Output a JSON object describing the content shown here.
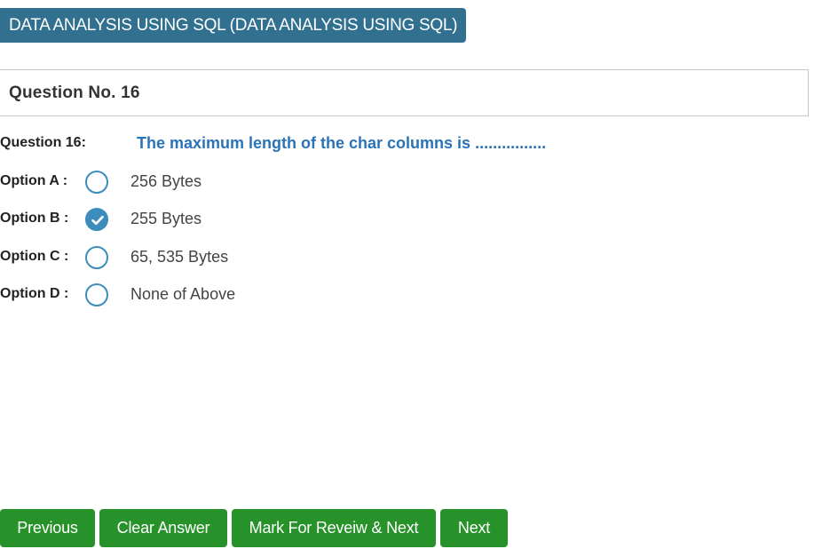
{
  "subject": {
    "title": "DATA ANALYSIS USING SQL (DATA ANALYSIS USING SQL)"
  },
  "question": {
    "header": "Question No. 16",
    "label": "Question 16:",
    "text": "The maximum length of the char columns is ................",
    "options": [
      {
        "label": "Option A :",
        "text": "256 Bytes",
        "selected": false
      },
      {
        "label": "Option B :",
        "text": "255 Bytes",
        "selected": true
      },
      {
        "label": "Option C :",
        "text": "65, 535 Bytes",
        "selected": false
      },
      {
        "label": "Option D :",
        "text": "None of Above",
        "selected": false
      }
    ]
  },
  "actions": {
    "previous": "Previous",
    "clear": "Clear Answer",
    "mark_review_next": "Mark For Reveiw & Next",
    "next": "Next"
  },
  "colors": {
    "badge": "#31708f",
    "question_text": "#2a73b8",
    "radio": "#3c8dbc",
    "button": "#28922a"
  },
  "icons": {
    "selected_radio": "check-icon"
  }
}
